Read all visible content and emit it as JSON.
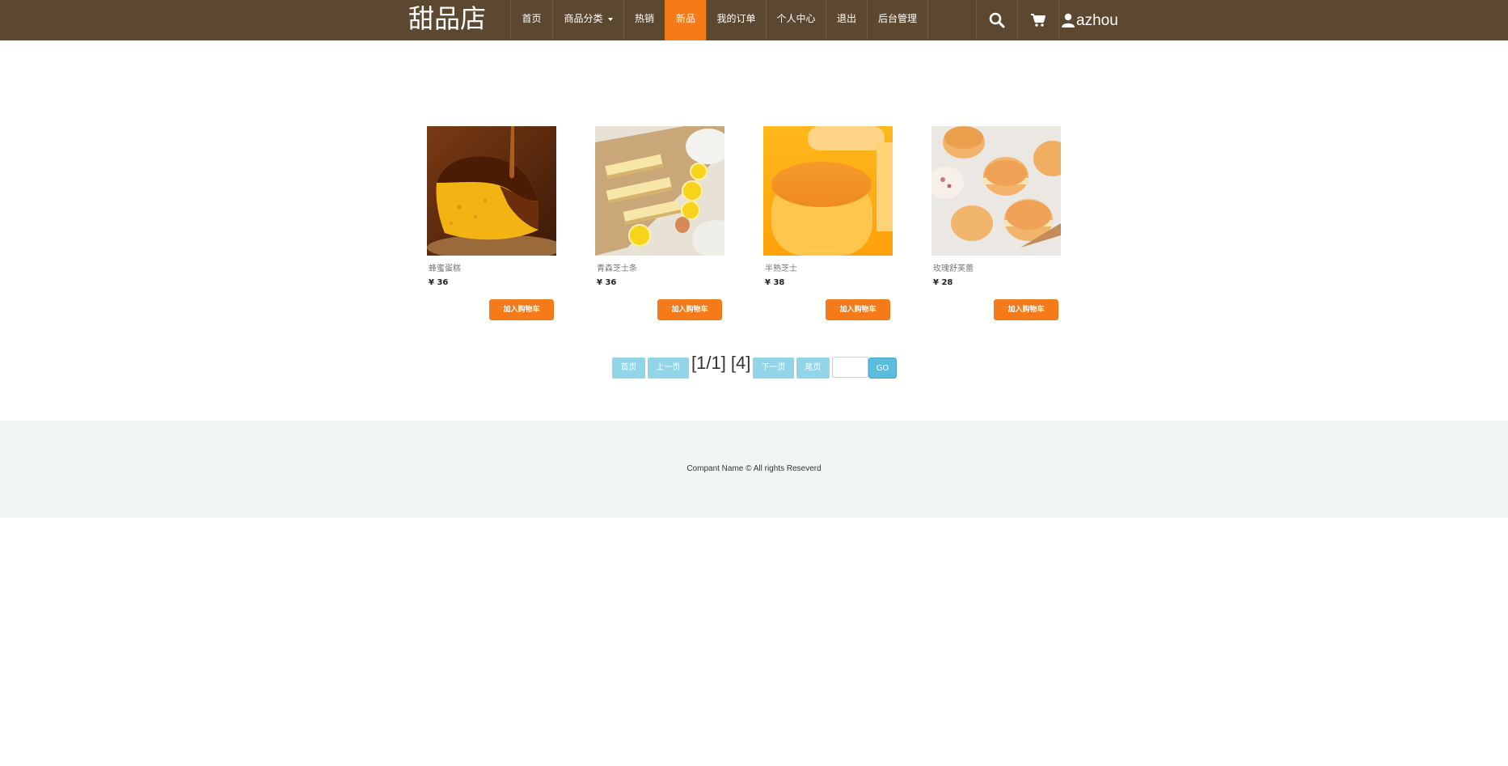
{
  "brand": "甜品店",
  "nav": {
    "home": "首页",
    "categories": "商品分类",
    "hot": "热销",
    "new": "新品",
    "orders": "我的订单",
    "profile": "个人中心",
    "logout": "退出",
    "admin": "后台管理",
    "active": "新品"
  },
  "user": {
    "name": "azhou"
  },
  "icons": {
    "search": "search-icon",
    "cart": "cart-icon",
    "user": "user-icon"
  },
  "colors": {
    "navbar": "#5c4731",
    "accent": "#f47a1a",
    "pager": "#92d4e8",
    "go": "#5bbcdd",
    "footer": "#f2f5f5"
  },
  "products": [
    {
      "name": "蜂蜜蛋糕",
      "price": "¥ 36",
      "button": "加入购物车"
    },
    {
      "name": "青森芝士条",
      "price": "¥ 36",
      "button": "加入购物车"
    },
    {
      "name": "半熟芝士",
      "price": "¥ 38",
      "button": "加入购物车"
    },
    {
      "name": "玫瑰舒芙蕾",
      "price": "¥ 28",
      "button": "加入购物车"
    }
  ],
  "pagination": {
    "first": "首页",
    "prev": "上一页",
    "info": "[1/1] [4]",
    "next": "下一页",
    "last": "尾页",
    "input_value": "",
    "go": "GO"
  },
  "footer": {
    "text": "Compant Name © All rights Reseverd"
  }
}
